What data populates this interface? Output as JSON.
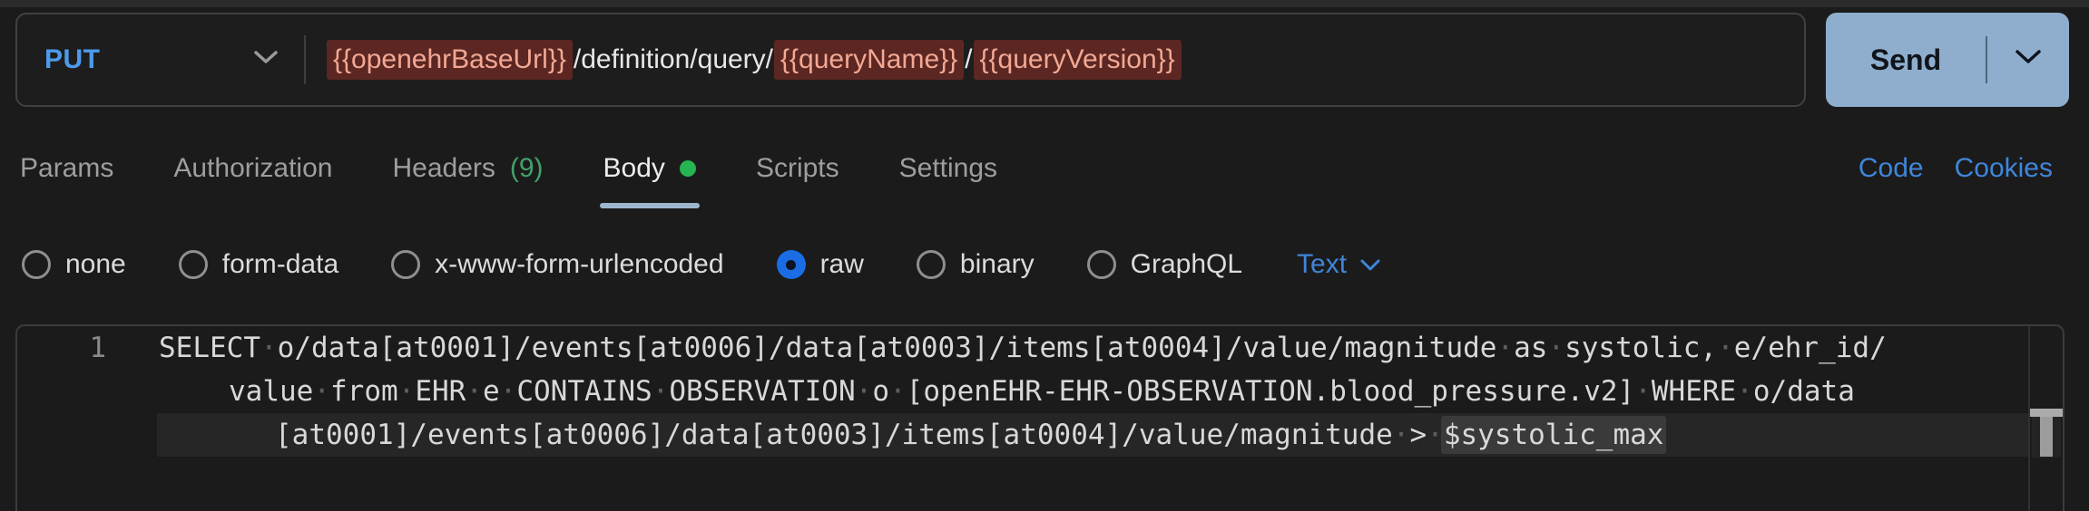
{
  "request": {
    "method": "PUT",
    "url_segments": [
      {
        "text": "{{openehrBaseUrl}}",
        "variable": true
      },
      {
        "text": "/definition/query/",
        "variable": false
      },
      {
        "text": "{{queryName}}",
        "variable": true
      },
      {
        "text": "/",
        "variable": false
      },
      {
        "text": "{{queryVersion}}",
        "variable": true
      }
    ],
    "send_label": "Send"
  },
  "tabs": {
    "items": [
      {
        "label": "Params"
      },
      {
        "label": "Authorization"
      },
      {
        "label": "Headers",
        "count": "(9)"
      },
      {
        "label": "Body",
        "active": true,
        "modified": true
      },
      {
        "label": "Scripts"
      },
      {
        "label": "Settings"
      }
    ],
    "right_links": {
      "code": "Code",
      "cookies": "Cookies"
    }
  },
  "body_options": {
    "radios": [
      {
        "label": "none",
        "selected": false
      },
      {
        "label": "form-data",
        "selected": false
      },
      {
        "label": "x-www-form-urlencoded",
        "selected": false
      },
      {
        "label": "raw",
        "selected": true
      },
      {
        "label": "binary",
        "selected": false
      },
      {
        "label": "GraphQL",
        "selected": false
      }
    ],
    "format_selector": "Text"
  },
  "editor": {
    "lines": [
      {
        "number": "1",
        "segments": [
          {
            "text": "SELECT o/data[at0001]/events[at0006]/data[at0003]/items[at0004]/value/magnitude as systolic, e/ehr_id/"
          }
        ]
      },
      {
        "segments": [
          {
            "text": "value from EHR e CONTAINS OBSERVATION o [openEHR-EHR-OBSERVATION.blood_pressure.v2] WHERE o/data"
          }
        ]
      },
      {
        "current": true,
        "segments": [
          {
            "text": "[at0001]/events[at0006]/data[at0003]/items[at0004]/value/magnitude > "
          },
          {
            "text": "$systolic_max",
            "highlight": true
          }
        ]
      }
    ]
  },
  "colors": {
    "method_blue": "#4C9BE8",
    "variable_bg": "#5C2722",
    "variable_text": "#F2A894",
    "send_bg": "#8FAECE",
    "send_text": "#10141B",
    "link_blue": "#3E86DB",
    "headers_count_green": "#42A169",
    "body_dot_green": "#26B551",
    "active_tab_underline": "#9EB7CE",
    "radio_selected_blue": "#1A6DE5",
    "editor_current_line_bg": "#262626",
    "token_highlight_bg": "#3A3A3A"
  }
}
